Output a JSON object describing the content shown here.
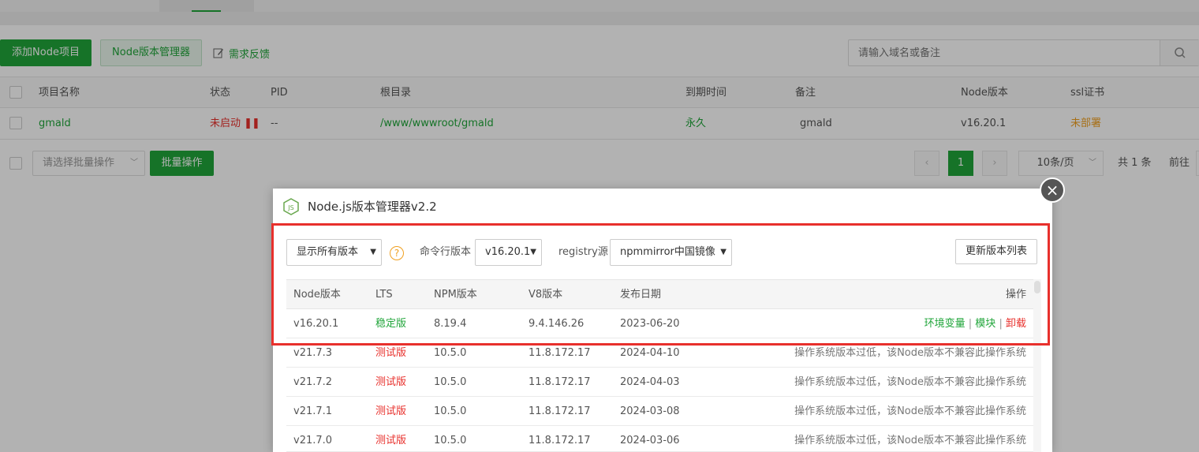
{
  "toolbar": {
    "add_project": "添加Node项目",
    "version_manager": "Node版本管理器",
    "feedback": "需求反馈",
    "search_placeholder": "请输入域名或备注"
  },
  "project_table": {
    "headers": [
      "项目名称",
      "状态",
      "PID",
      "根目录",
      "到期时间",
      "备注",
      "Node版本",
      "ssl证书"
    ],
    "rows": [
      {
        "name": "gmald",
        "status": "未启动",
        "pid": "--",
        "root": "/www/wwwroot/gmald",
        "expire": "永久",
        "remark": "gmald",
        "node_version": "v16.20.1",
        "ssl": "未部署"
      }
    ]
  },
  "footer": {
    "batch_select": "请选择批量操作",
    "batch_button": "批量操作",
    "prev": "‹",
    "page": "1",
    "next": "›",
    "page_size": "10条/页",
    "total": "共 1 条",
    "goto": "前往"
  },
  "modal": {
    "title": "Node.js版本管理器v2.2",
    "close": "×",
    "filter_select": "显示所有版本",
    "help": "?",
    "cli_version_label": "命令行版本",
    "cli_version_value": "v16.20.1",
    "registry_label": "registry源",
    "registry_value": "npmmirror中国镜像",
    "update_button": "更新版本列表",
    "table_headers": {
      "node": "Node版本",
      "lts": "LTS",
      "npm": "NPM版本",
      "v8": "V8版本",
      "date": "发布日期",
      "action": "操作"
    },
    "installed": {
      "node": "v16.20.1",
      "lts": "稳定版",
      "npm": "8.19.4",
      "v8": "9.4.146.26",
      "date": "2023-06-20",
      "env": "环境变量",
      "sep1": "|",
      "module": "模块",
      "sep2": "|",
      "uninstall": "卸载"
    },
    "rows": [
      {
        "node": "v21.7.3",
        "lts": "测试版",
        "npm": "10.5.0",
        "v8": "11.8.172.17",
        "date": "2024-04-10",
        "action": "操作系统版本过低，该Node版本不兼容此操作系统"
      },
      {
        "node": "v21.7.2",
        "lts": "测试版",
        "npm": "10.5.0",
        "v8": "11.8.172.17",
        "date": "2024-04-03",
        "action": "操作系统版本过低，该Node版本不兼容此操作系统"
      },
      {
        "node": "v21.7.1",
        "lts": "测试版",
        "npm": "10.5.0",
        "v8": "11.8.172.17",
        "date": "2024-03-08",
        "action": "操作系统版本过低，该Node版本不兼容此操作系统"
      },
      {
        "node": "v21.7.0",
        "lts": "测试版",
        "npm": "10.5.0",
        "v8": "11.8.172.17",
        "date": "2024-03-06",
        "action": "操作系统版本过低，该Node版本不兼容此操作系统"
      }
    ]
  },
  "colors": {
    "accent_green": "#20a53a",
    "danger_red": "#e8302c",
    "warning_orange": "#f0a020"
  }
}
